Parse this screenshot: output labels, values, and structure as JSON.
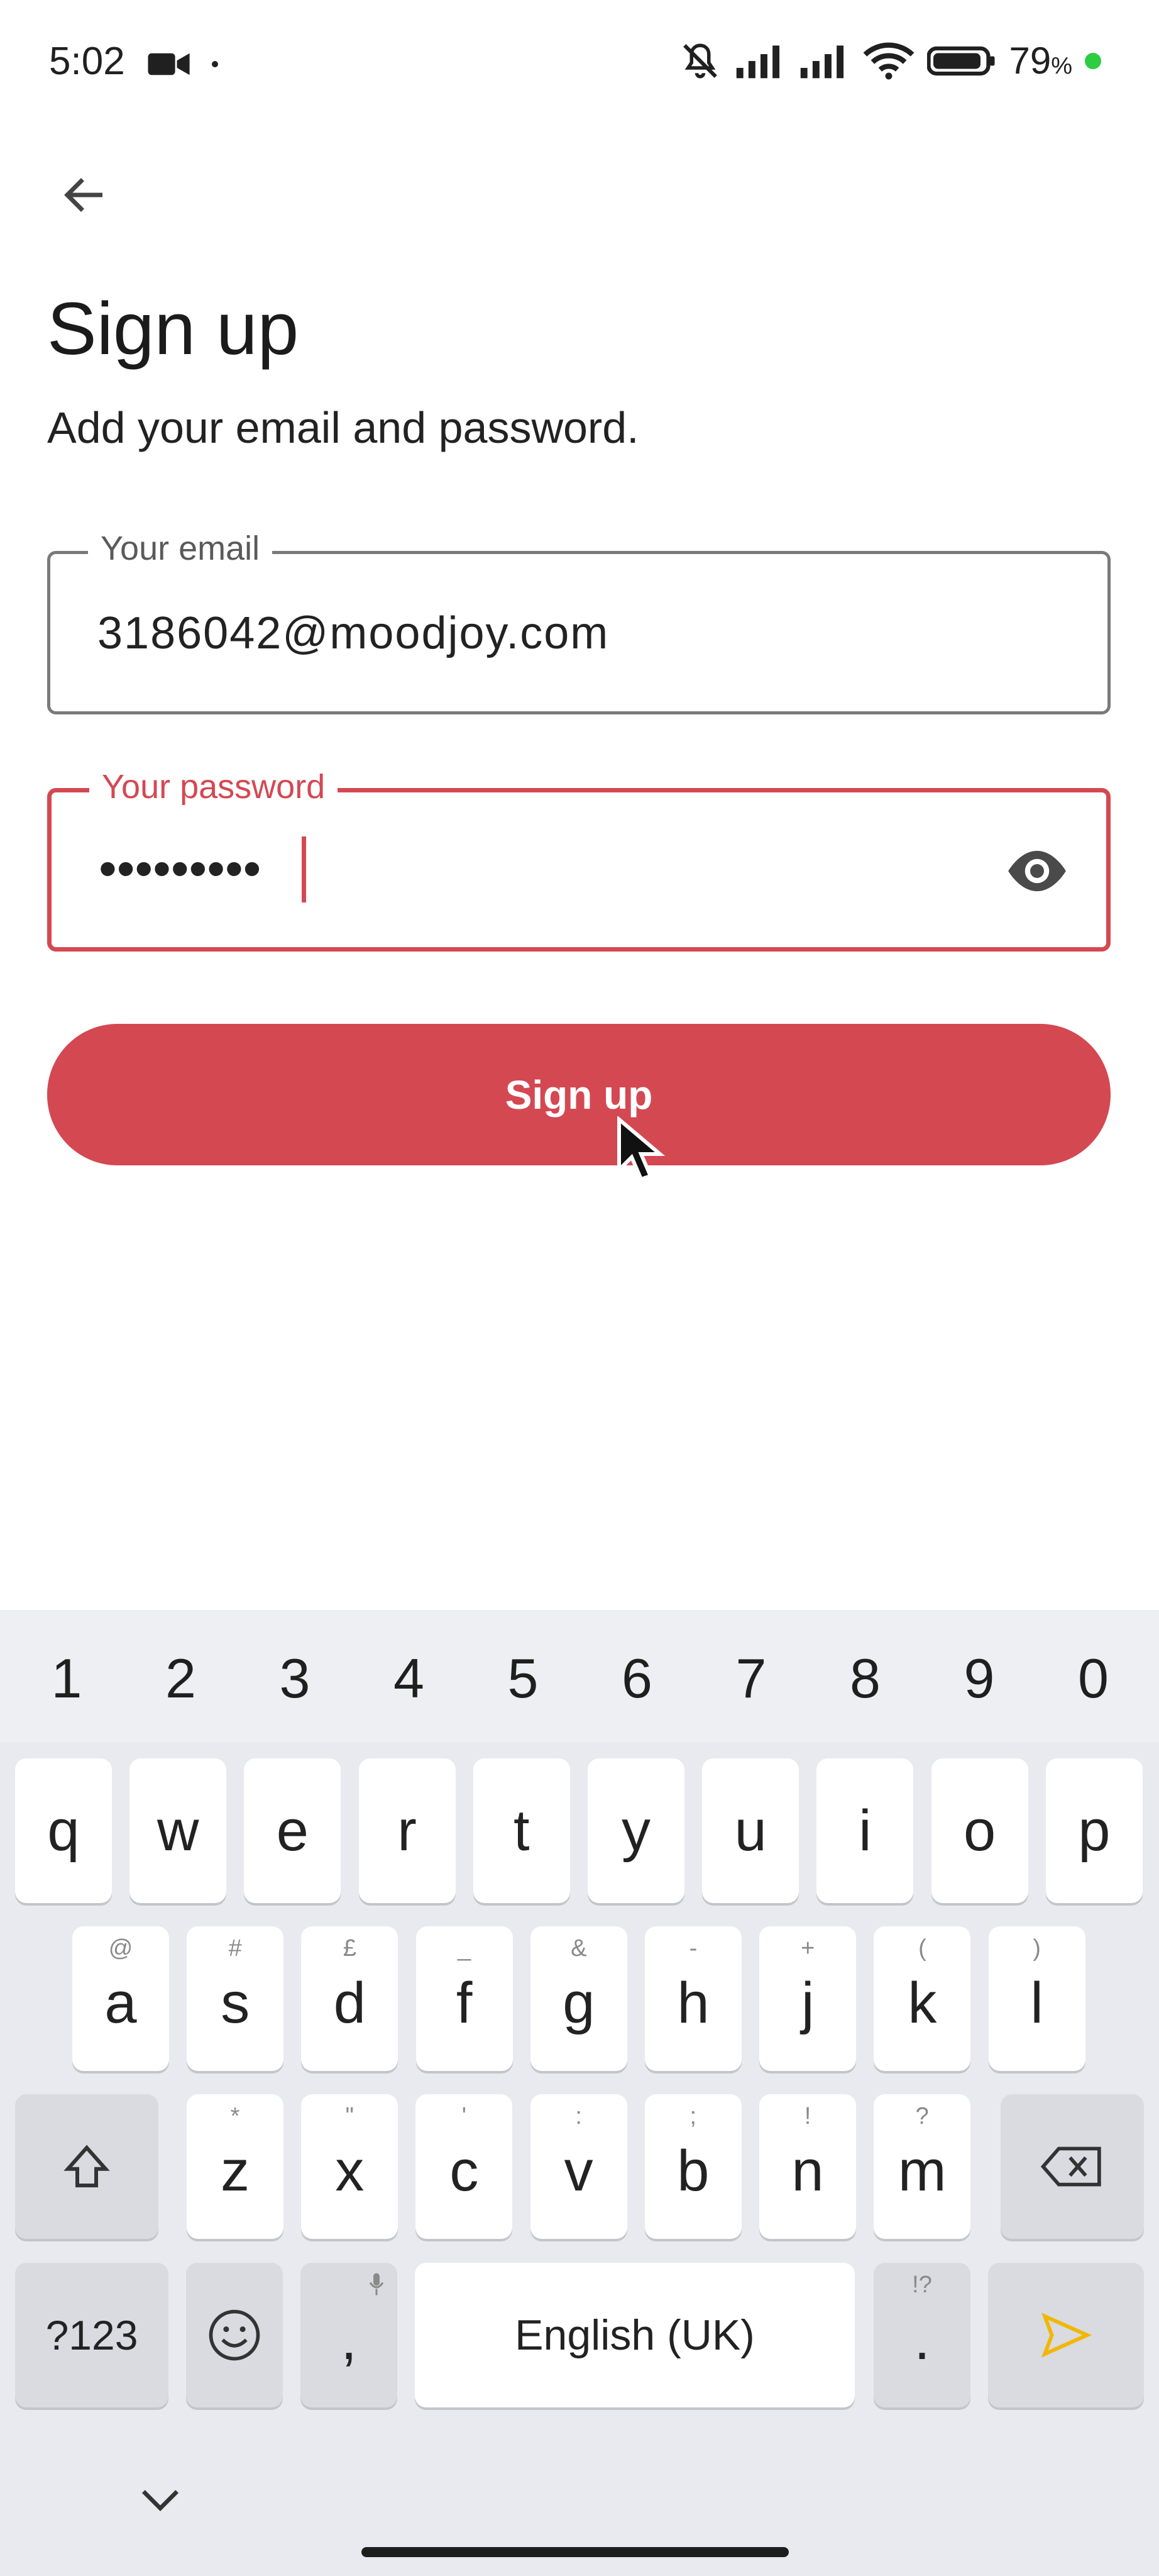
{
  "status_bar": {
    "time": "5:02",
    "battery": "79",
    "battery_unit": "%"
  },
  "header": {
    "title": "Sign up",
    "subtitle": "Add your email and password."
  },
  "email_field": {
    "label": "Your email",
    "value": "3186042@moodjoy.com"
  },
  "password_field": {
    "label": "Your password",
    "masked_value": "•••••••••"
  },
  "signup_button": {
    "label": "Sign up"
  },
  "keyboard": {
    "numbers": [
      "1",
      "2",
      "3",
      "4",
      "5",
      "6",
      "7",
      "8",
      "9",
      "0"
    ],
    "row1": [
      "q",
      "w",
      "e",
      "r",
      "t",
      "y",
      "u",
      "i",
      "o",
      "p"
    ],
    "row2": [
      {
        "key": "a",
        "hint": "@"
      },
      {
        "key": "s",
        "hint": "#"
      },
      {
        "key": "d",
        "hint": "£"
      },
      {
        "key": "f",
        "hint": "_"
      },
      {
        "key": "g",
        "hint": "&"
      },
      {
        "key": "h",
        "hint": "-"
      },
      {
        "key": "j",
        "hint": "+"
      },
      {
        "key": "k",
        "hint": "("
      },
      {
        "key": "l",
        "hint": ")"
      }
    ],
    "row3": [
      {
        "key": "z",
        "hint": "*"
      },
      {
        "key": "x",
        "hint": "\""
      },
      {
        "key": "c",
        "hint": "'"
      },
      {
        "key": "v",
        "hint": ":"
      },
      {
        "key": "b",
        "hint": ";"
      },
      {
        "key": "n",
        "hint": "!"
      },
      {
        "key": "m",
        "hint": "?"
      }
    ],
    "symbols_label": "?123",
    "comma": ",",
    "space_label": "English (UK)",
    "period": ".",
    "period_hint": "!?",
    "accent_color": "#f2b705"
  },
  "colors": {
    "primary": "#d44852"
  }
}
